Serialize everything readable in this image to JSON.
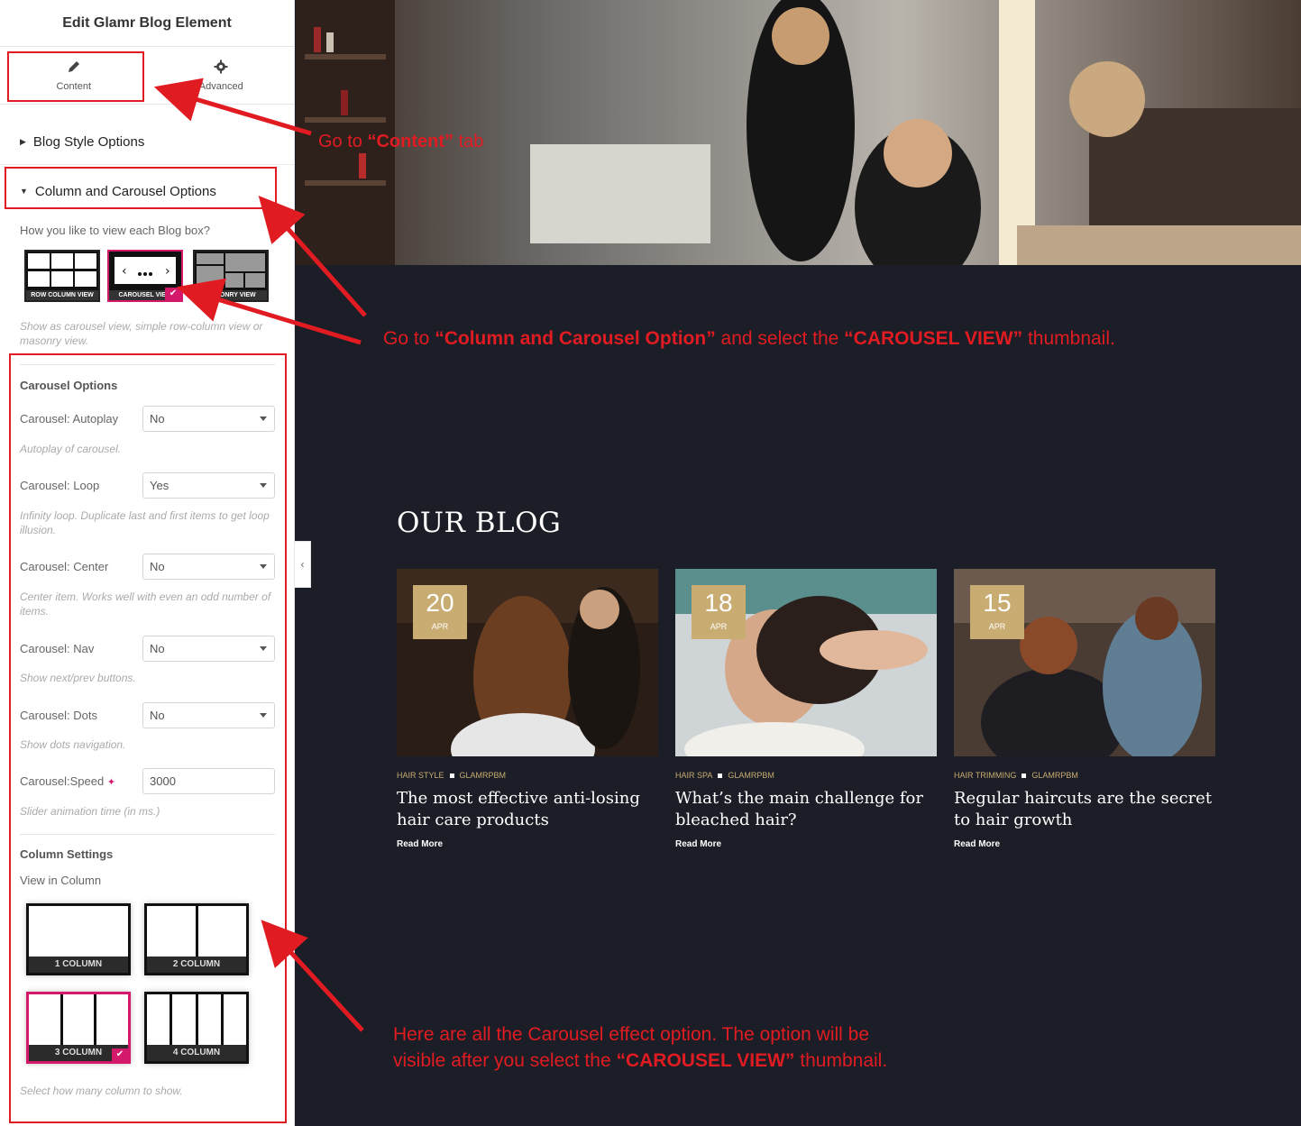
{
  "panel": {
    "title": "Edit Glamr Blog Element",
    "tabs": [
      {
        "label": "Content",
        "icon": "pencil-icon"
      },
      {
        "label": "Advanced",
        "icon": "gear-icon"
      }
    ],
    "sections": {
      "blog_style": "Blog Style Options",
      "column_carousel": "Column and Carousel Options"
    },
    "view_question": "How you like to view each Blog box?",
    "view_thumbs": [
      {
        "label": "ROW COLUMN VIEW"
      },
      {
        "label": "CAROUSEL VIEW",
        "selected": true
      },
      {
        "label": "MASONRY VIEW"
      }
    ],
    "view_hint": "Show as carousel view, simple row-column view or masonry view.",
    "carousel_options_title": "Carousel Options",
    "controls": [
      {
        "label": "Carousel: Autoplay",
        "value": "No",
        "hint": "Autoplay of carousel."
      },
      {
        "label": "Carousel: Loop",
        "value": "Yes",
        "hint": "Infinity loop. Duplicate last and first items to get loop illusion."
      },
      {
        "label": "Carousel: Center",
        "value": "No",
        "hint": "Center item. Works well with even an odd number of items."
      },
      {
        "label": "Carousel: Nav",
        "value": "No",
        "hint": "Show next/prev buttons."
      },
      {
        "label": "Carousel: Dots",
        "value": "No",
        "hint": "Show dots navigation."
      }
    ],
    "speed": {
      "label": "Carousel:Speed",
      "value": "3000",
      "hint": "Slider animation time (in ms.)"
    },
    "column_settings_title": "Column Settings",
    "view_in_column": "View in Column",
    "columns": [
      {
        "label": "1 COLUMN",
        "cells": 1
      },
      {
        "label": "2 COLUMN",
        "cells": 2
      },
      {
        "label": "3 COLUMN",
        "cells": 3,
        "selected": true
      },
      {
        "label": "4 COLUMN",
        "cells": 4
      }
    ],
    "column_hint": "Select how many column to show."
  },
  "preview": {
    "blog_heading": "OUR BLOG",
    "posts": [
      {
        "day": "20",
        "month": "APR",
        "category": "HAIR STYLE",
        "author": "GLAMRPBM",
        "title": "The most effective anti-losing hair care products",
        "more": "Read More"
      },
      {
        "day": "18",
        "month": "APR",
        "category": "HAIR SPA",
        "author": "GLAMRPBM",
        "title": "What’s the main challenge for bleached hair?",
        "more": "Read More"
      },
      {
        "day": "15",
        "month": "APR",
        "category": "HAIR TRIMMING",
        "author": "GLAMRPBM",
        "title": "Regular haircuts are the secret to hair growth",
        "more": "Read More"
      }
    ]
  },
  "annotations": {
    "a1": {
      "pre": "Go  to ",
      "bold": "“Content”",
      "post": " tab"
    },
    "a2": {
      "pre": "Go to ",
      "bold1": "“Column and Carousel Option”",
      "mid": " and select the ",
      "bold2": "“CAROUSEL VIEW”",
      "post": " thumbnail."
    },
    "a3": {
      "line1": "Here are all the Carousel effect option. The option will be",
      "pre2": "visible after you select the ",
      "bold": "“CAROUSEL VIEW”",
      "post2": " thumbnail."
    }
  },
  "colors": {
    "accent": "#c9ac72",
    "annotation": "#e11b22",
    "check": "#d4196b",
    "dark_bg": "#1b1e26"
  }
}
